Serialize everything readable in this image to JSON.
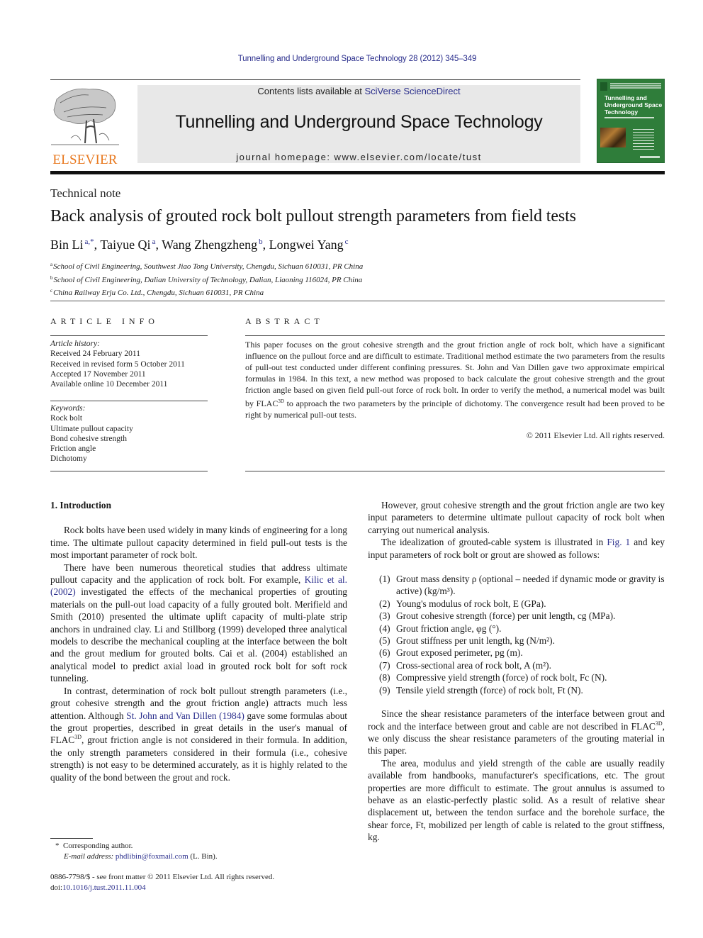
{
  "header": {
    "citation": "Tunnelling and Underground Space Technology 28 (2012) 345–349",
    "contents_prefix": "Contents lists available at ",
    "contents_link": "SciVerse ScienceDirect",
    "journal_title": "Tunnelling and Underground Space Technology",
    "homepage": "journal homepage: www.elsevier.com/locate/tust",
    "publisher_logo_text": "ELSEVIER",
    "cover": {
      "title_lines": [
        "Tunnelling and",
        "Underground Space",
        "Technology"
      ]
    }
  },
  "colors": {
    "link": "#2a2e8c",
    "elsevier_orange": "#e8781e",
    "cover_green": "#2f7d3a",
    "masthead_bg": "#e8e8e8"
  },
  "article": {
    "type": "Technical note",
    "title": "Back analysis of grouted rock bolt pullout strength parameters from field tests",
    "authors": [
      {
        "name": "Bin Li",
        "sup": "a,*"
      },
      {
        "name": "Taiyue Qi",
        "sup": "a"
      },
      {
        "name": "Wang Zhengzheng",
        "sup": "b"
      },
      {
        "name": "Longwei Yang",
        "sup": "c"
      }
    ],
    "affiliations": [
      {
        "mark": "a",
        "text": "School of Civil Engineering, Southwest Jiao Tong University, Chengdu, Sichuan 610031, PR China"
      },
      {
        "mark": "b",
        "text": "School of Civil Engineering, Dalian University of Technology, Dalian, Liaoning 116024, PR China"
      },
      {
        "mark": "c",
        "text": "China Railway Erju Co. Ltd., Chengdu, Sichuan 610031, PR China"
      }
    ]
  },
  "article_info": {
    "heading": "ARTICLE INFO",
    "history_label": "Article history:",
    "history": [
      "Received 24 February 2011",
      "Received in revised form 5 October 2011",
      "Accepted 17 November 2011",
      "Available online 10 December 2011"
    ],
    "keywords_label": "Keywords:",
    "keywords": [
      "Rock bolt",
      "Ultimate pullout capacity",
      "Bond cohesive strength",
      "Friction angle",
      "Dichotomy"
    ]
  },
  "abstract": {
    "heading": "ABSTRACT",
    "text_before_sup": "This paper focuses on the grout cohesive strength and the grout friction angle of rock bolt, which have a significant influence on the pullout force and are difficult to estimate. Traditional method estimate the two parameters from the results of pull-out test conducted under different confining pressures. St. John and Van Dillen gave two approximate empirical formulas in 1984. In this text, a new method was proposed to back calculate the grout cohesive strength and the grout friction angle based on given field pull-out force of rock bolt. In order to verify the method, a numerical model was built by FLAC",
    "sup": "3D",
    "text_after_sup": " to approach the two parameters by the principle of dichotomy. The convergence result had been proved to be right by numerical pull-out tests.",
    "copyright": "© 2011 Elsevier Ltd. All rights reserved."
  },
  "body": {
    "section1_heading": "1. Introduction",
    "left": {
      "p1": "Rock bolts have been used widely in many kinds of engineering for a long time. The ultimate pullout capacity determined in field pull-out tests is the most important parameter of rock bolt.",
      "p2_a": "There have been numerous theoretical studies that address ultimate pullout capacity and the application of rock bolt. For example, ",
      "p2_link": "Kilic et al. (2002)",
      "p2_b": " investigated the effects of the mechanical properties of grouting materials on the pull-out load capacity of a fully grouted bolt. Merifield and Smith (2010) presented the ultimate uplift capacity of multi-plate strip anchors in undrained clay. Li and Stillborg (1999) developed three analytical models to describe the mechanical coupling at the interface between the bolt and the grout medium for grouted bolts. Cai et al. (2004) established an analytical model to predict axial load in grouted rock bolt for soft rock tunneling.",
      "p3_a": "In contrast, determination of rock bolt pullout strength parameters (i.e., grout cohesive strength and the grout friction angle) attracts much less attention. Although ",
      "p3_link": "St. John and Van Dillen (1984)",
      "p3_b": " gave some formulas about the grout properties, described in great details in the user's manual of FLAC",
      "p3_sup": "3D",
      "p3_c": ", grout friction angle is not considered in their formula. In addition, the only strength parameters considered in their formula (i.e., cohesive strength) is not easy to be determined accurately, as it is highly related to the quality of the bond between the grout and rock."
    },
    "right": {
      "p1": "However, grout cohesive strength and the grout friction angle are two key input parameters to determine ultimate pullout capacity of rock bolt when carrying out numerical analysis.",
      "p2_a": "The idealization of grouted-cable system is illustrated in ",
      "p2_link": "Fig. 1",
      "p2_b": " and key input parameters of rock bolt or grout are showed as follows:",
      "list": [
        {
          "num": "(1)",
          "text": "Grout mass density ρ (optional – needed if dynamic mode or gravity is active) (kg/m³)."
        },
        {
          "num": "(2)",
          "text": "Young's modulus of rock bolt, E (GPa)."
        },
        {
          "num": "(3)",
          "text": "Grout cohesive strength (force) per unit length, cg (MPa)."
        },
        {
          "num": "(4)",
          "text": "Grout friction angle, φg (°)."
        },
        {
          "num": "(5)",
          "text": "Grout stiffness per unit length, kg (N/m²)."
        },
        {
          "num": "(6)",
          "text": "Grout exposed perimeter, pg (m)."
        },
        {
          "num": "(7)",
          "text": "Cross-sectional area of rock bolt, A (m²)."
        },
        {
          "num": "(8)",
          "text": "Compressive yield strength (force) of rock bolt, Fc (N)."
        },
        {
          "num": "(9)",
          "text": "Tensile yield strength (force) of rock bolt, Ft (N)."
        }
      ],
      "p3_a": "Since the shear resistance parameters of the interface between grout and rock and the interface between grout and cable are not described in FLAC",
      "p3_sup": "3D",
      "p3_b": ", we only discuss the shear resistance parameters of the grouting material in this paper.",
      "p4": "The area, modulus and yield strength of the cable are usually readily available from handbooks, manufacturer's specifications, etc. The grout properties are more difficult to estimate. The grout annulus is assumed to behave as an elastic-perfectly plastic solid. As a result of relative shear displacement ut, between the tendon surface and the borehole surface, the shear force, Ft, mobilized per length of cable is related to the grout stiffness, kg."
    }
  },
  "footnote": {
    "mark": "*",
    "corresponding": "Corresponding author.",
    "email_label": "E-mail address:",
    "email": "phdlibin@foxmail.com",
    "email_suffix": " (L. Bin)."
  },
  "issn": {
    "line1": "0886-7798/$ - see front matter © 2011 Elsevier Ltd. All rights reserved.",
    "doi_prefix": "doi:",
    "doi": "10.1016/j.tust.2011.11.004"
  }
}
